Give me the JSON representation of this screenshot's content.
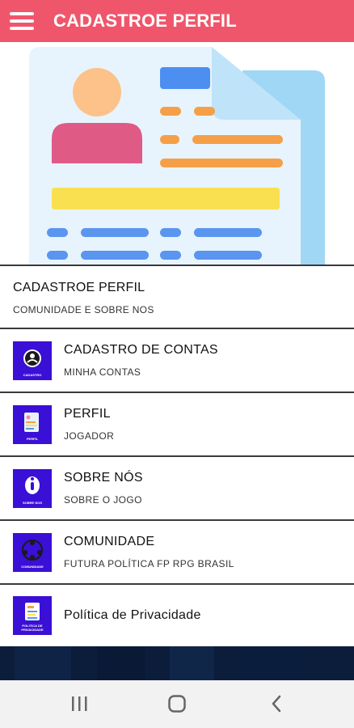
{
  "appbar": {
    "title": "CADASTROE PERFIL",
    "menu_icon": "hamburger-menu-icon"
  },
  "hero": {
    "illustration": "profile-document-illustration"
  },
  "list": {
    "header": {
      "title": "CADASTROE PERFIL",
      "subtitle": "COMUNIDADE E SOBRE NOS"
    },
    "items": [
      {
        "title": "CADASTRO DE CONTAS",
        "subtitle": "MINHA CONTAS",
        "thumb_caption": "CADASTRO",
        "icon": "user-circle-icon"
      },
      {
        "title": "PERFIL",
        "subtitle": "JOGADOR",
        "thumb_caption": "PERFIL",
        "icon": "profile-card-icon"
      },
      {
        "title": "SOBRE NÓS",
        "subtitle": "SOBRE O JOGO",
        "thumb_caption": "SOBRE NOS",
        "icon": "info-chat-icon"
      },
      {
        "title": "COMUNIDADE",
        "subtitle": "FUTURA POLÍTICA FP RPG BRASIL",
        "thumb_caption": "COMUNIDADE",
        "icon": "community-network-icon"
      },
      {
        "title": "Política de Privacidade",
        "subtitle": "",
        "thumb_caption": "POLITICA DE PRIVACIDADE",
        "icon": "privacy-document-icon"
      }
    ]
  },
  "navbar": {
    "recents_icon": "recents-icon",
    "home_icon": "home-icon",
    "back_icon": "back-icon"
  },
  "colors": {
    "appbar": "#f0566b",
    "thumb": "#3a0fd6",
    "bottom_strip": "#0c1c3b",
    "navbar": "#f2f2f2"
  }
}
